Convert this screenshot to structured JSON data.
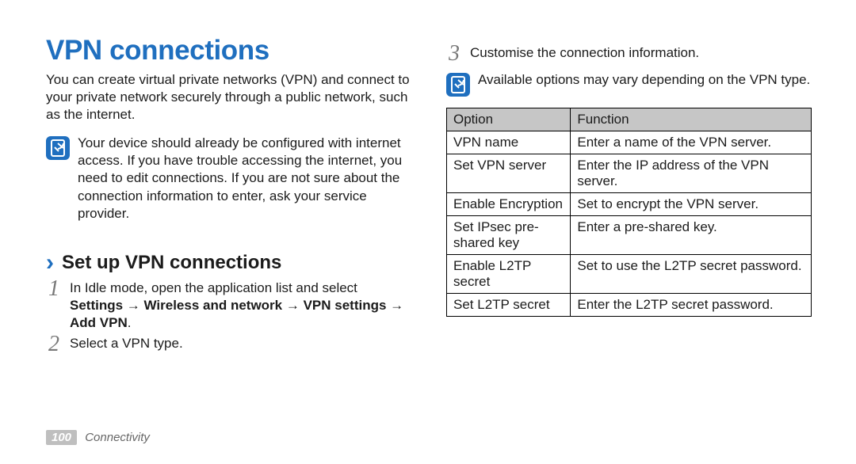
{
  "title": "VPN connections",
  "intro": "You can create virtual private networks (VPN) and connect to your private network securely through a public network, such as the internet.",
  "note1": "Your device should already be configured with internet access. If you have trouble accessing the internet, you need to edit connections. If you are not sure about the connection information to enter, ask your service provider.",
  "sub_heading": "Set up VPN connections",
  "step1_a": "In Idle mode, open the application list and select ",
  "step1_b": "Settings → Wireless and network → VPN settings → Add VPN",
  "step1_c": ".",
  "step2": "Select a VPN type.",
  "step3": "Customise the connection information.",
  "note2": "Available options may vary depending on the VPN type.",
  "table": {
    "head_option": "Option",
    "head_function": "Function",
    "rows": [
      {
        "opt": "VPN name",
        "fun": "Enter a name of the VPN server."
      },
      {
        "opt": "Set VPN server",
        "fun": "Enter the IP address of the VPN server."
      },
      {
        "opt": "Enable Encryption",
        "fun": "Set to encrypt the VPN server."
      },
      {
        "opt": "Set IPsec pre-shared key",
        "fun": "Enter a pre-shared key."
      },
      {
        "opt": "Enable L2TP secret",
        "fun": "Set to use the L2TP secret password."
      },
      {
        "opt": "Set L2TP secret",
        "fun": "Enter the L2TP secret password."
      }
    ]
  },
  "footer_page": "100",
  "footer_section": "Connectivity"
}
